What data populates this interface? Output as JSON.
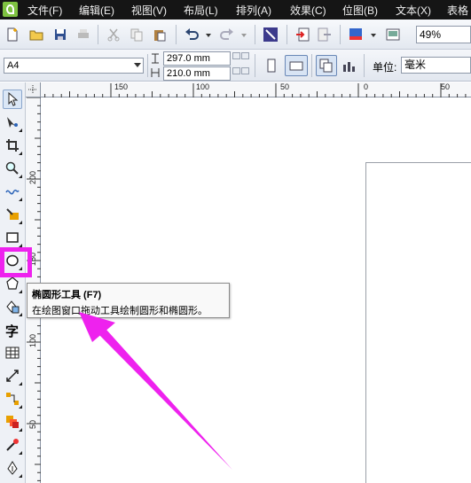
{
  "menubar": {
    "items": [
      "文件(F)",
      "编辑(E)",
      "视图(V)",
      "布局(L)",
      "排列(A)",
      "效果(C)",
      "位图(B)",
      "文本(X)",
      "表格"
    ]
  },
  "toolbar": {
    "zoom_value": "49%"
  },
  "property_bar": {
    "paper_size": "A4",
    "width_value": "297.0 mm",
    "height_value": "210.0 mm",
    "units_label": "单位:",
    "units_value": "毫米"
  },
  "ruler": {
    "horizontal_labels": [
      "150",
      "100",
      "50",
      "0",
      "50"
    ],
    "vertical_labels": [
      "200",
      "150",
      "100",
      "50"
    ]
  },
  "tooltip": {
    "title": "椭圆形工具 (F7)",
    "description": "在绘图窗口拖动工具绘制圆形和椭圆形。"
  },
  "toolbox": {
    "text_tool_glyph": "字"
  },
  "colors": {
    "highlight": "#ee22ee",
    "menubar_bg": "#151515"
  }
}
